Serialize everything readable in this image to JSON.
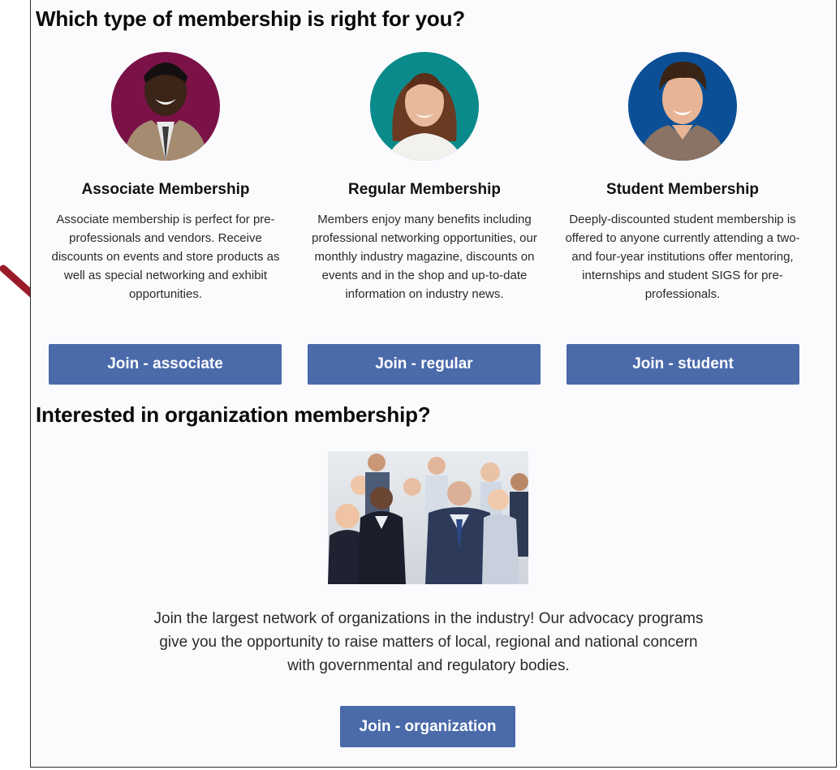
{
  "page": {
    "heading": "Which type of membership is right for you?",
    "org_heading": "Interested in organization membership?"
  },
  "memberships": [
    {
      "title": "Associate Membership",
      "description": "Associate membership is perfect for pre-professionals and vendors. Receive discounts on events and store products as well as special networking and exhibit opportunities.",
      "button": "Join - associate",
      "avatar_bg": "#7a1248"
    },
    {
      "title": "Regular Membership",
      "description": "Members enjoy many benefits including professional networking opportunities, our monthly industry magazine, discounts on events and in the shop and up-to-date information on industry news.",
      "button": "Join - regular",
      "avatar_bg": "#0a8a8a"
    },
    {
      "title": "Student Membership",
      "description": "Deeply-discounted student membership is offered to anyone currently attending a two- and four-year institutions offer mentoring, internships and student SIGS for pre-professionals.",
      "button": "Join - student",
      "avatar_bg": "#0b4f96"
    }
  ],
  "organization": {
    "description": "Join the largest network of organizations in the industry! Our advocacy programs give you the opportunity to raise matters of local, regional and national concern with governmental and regulatory bodies.",
    "button": "Join - organization"
  },
  "colors": {
    "button_bg": "#4a6aaa",
    "arrow": "#9b1b2a"
  }
}
